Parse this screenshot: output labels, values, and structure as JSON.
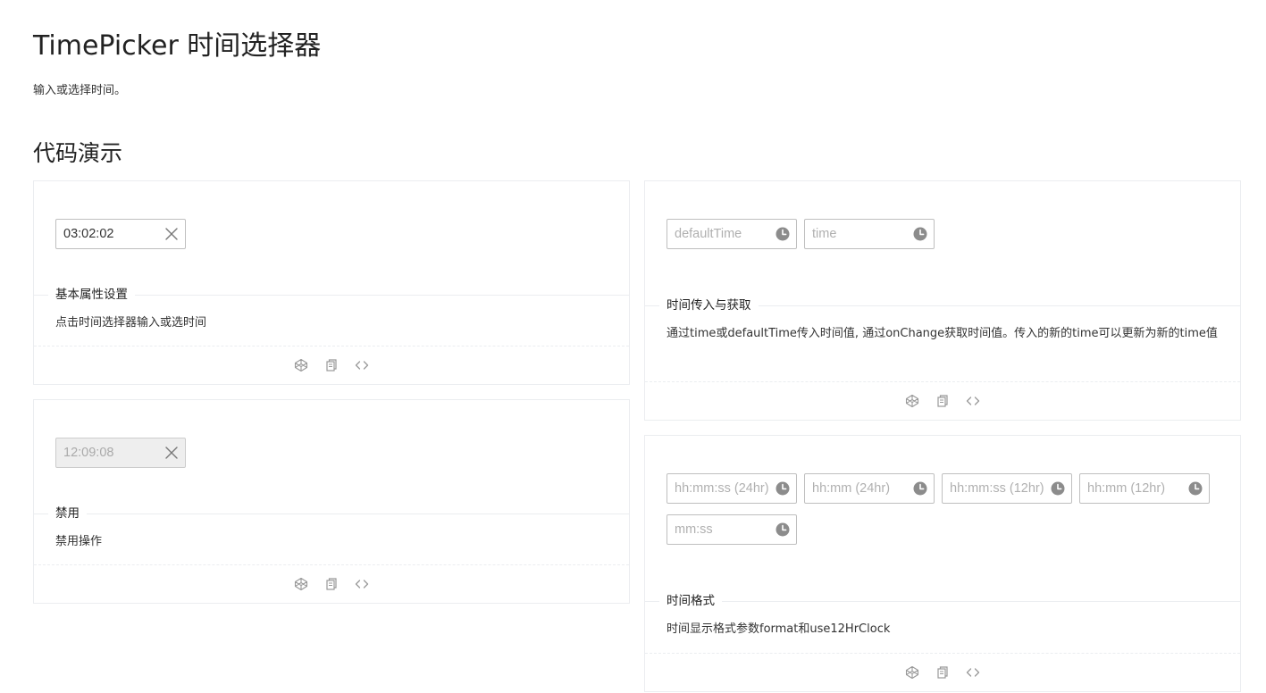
{
  "page": {
    "title": "TimePicker 时间选择器",
    "description": "输入或选择时间。",
    "section_title": "代码演示"
  },
  "demos": {
    "basic": {
      "value": "03:02:02",
      "title": "基本属性设置",
      "description": "点击时间选择器输入或选时间"
    },
    "controlled": {
      "placeholder_default": "defaultTime",
      "placeholder_time": "time",
      "title": "时间传入与获取",
      "description": "通过time或defaultTime传入时间值, 通过onChange获取时间值。传入的新的time可以更新为新的time值"
    },
    "disabled": {
      "value": "12:09:08",
      "title": "禁用",
      "description": "禁用操作"
    },
    "format": {
      "placeholders": [
        "hh:mm:ss (24hr)",
        "hh:mm (24hr)",
        "hh:mm:ss (12hr)",
        "hh:mm (12hr)",
        "mm:ss"
      ],
      "title": "时间格式",
      "description": "时间显示格式参数format和use12HrClock"
    }
  },
  "icons": {
    "clear": "close-icon",
    "clock": "clock-icon",
    "codepen": "codepen-icon",
    "copy": "copy-icon",
    "code": "code-icon"
  },
  "colors": {
    "border": "#ebedf0",
    "input_border": "#bfbfbf",
    "clock_fill": "#8c8c8c",
    "disabled_bg": "#eeeeee"
  }
}
